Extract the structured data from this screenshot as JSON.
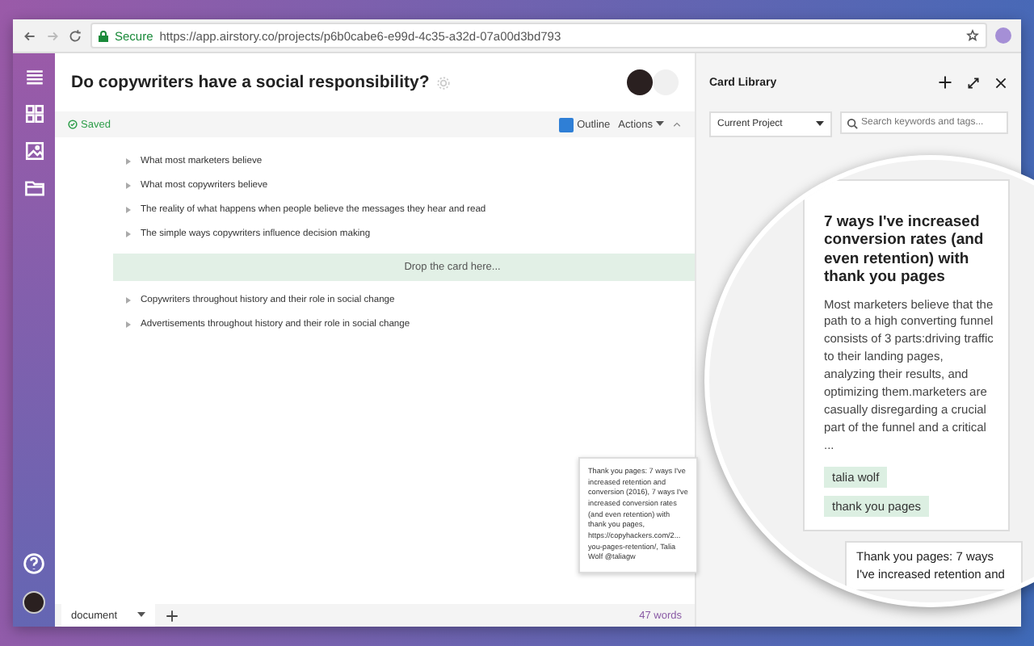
{
  "browser": {
    "secure_label": "Secure",
    "url": "https://app.airstory.co/projects/p6b0cabe6-e99d-4c35-a32d-07a00d3bd793"
  },
  "document": {
    "title": "Do copywriters have a social responsibility?",
    "status": "Saved",
    "outline": {
      "label": "Outline",
      "checked": true
    },
    "actions": "Actions",
    "items": [
      {
        "kind": "heading",
        "text": "What most marketers believe"
      },
      {
        "kind": "heading",
        "text": "What most copywriters believe"
      },
      {
        "kind": "heading",
        "text": "The reality of what happens when people believe the messages they hear and read"
      },
      {
        "kind": "heading",
        "text": "The simple ways copywriters influence decision making"
      },
      {
        "kind": "drop-zone",
        "text": "Drop the card here..."
      },
      {
        "kind": "heading",
        "text": "Copywriters throughout history and their role in social change"
      },
      {
        "kind": "heading",
        "text": "Advertisements throughout history and their role in social change"
      }
    ],
    "tab": "document",
    "word_count": "47 words"
  },
  "card_library": {
    "title": "Card Library",
    "filter": "Current Project",
    "search_placeholder": "Search keywords and tags..."
  },
  "dragged_card": {
    "text": "Thank you pages: 7 ways I've increased retention and conversion (2016), 7 ways I've increased conversion rates (and even retention) with thank you pages, https://copyhackers.com/2... you-pages-retention/, Talia Wolf @taliagw"
  },
  "magnifier": {
    "card": {
      "title": "7 ways I've increased conversion rates (and even retention) with thank you pages",
      "body": "Most marketers believe that the path to a high converting funnel consists of 3 parts:driving traffic to their landing pages, analyzing their results, and optimizing them.marketers are casually disregarding a crucial part of the funnel and a critical ...",
      "tags": [
        "talia wolf",
        "thank you pages"
      ]
    },
    "next_card_text": "Thank you pages: 7 ways I've increased retention and"
  }
}
